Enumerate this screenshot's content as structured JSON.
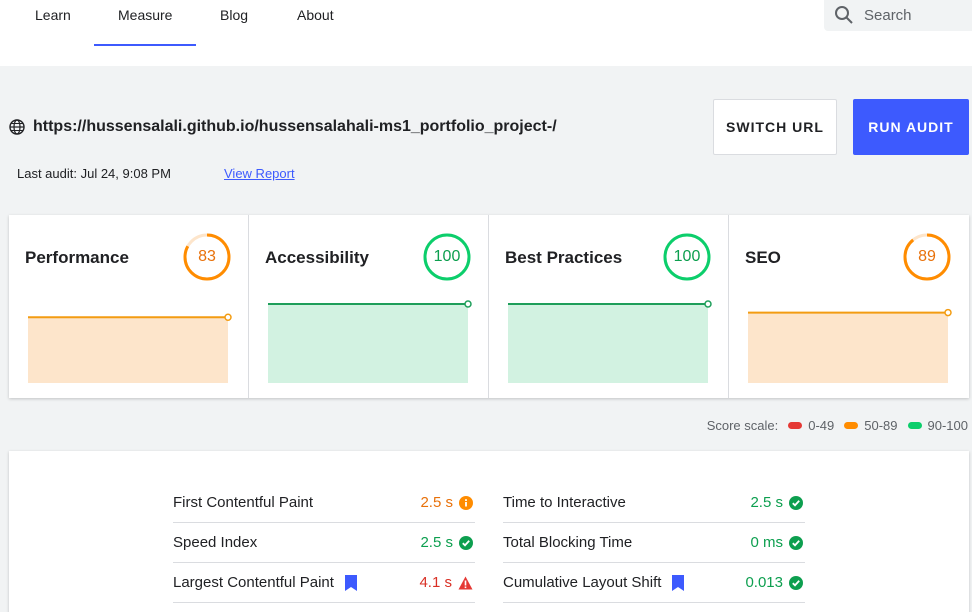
{
  "nav": {
    "items": [
      {
        "label": "Learn",
        "active": false
      },
      {
        "label": "Measure",
        "active": true
      },
      {
        "label": "Blog",
        "active": false
      },
      {
        "label": "About",
        "active": false
      }
    ],
    "search_placeholder": "Search"
  },
  "audit": {
    "url": "https://hussensalali.github.io/hussensalahali-ms1_portfolio_project-/",
    "switch_label": "SWITCH URL",
    "run_label": "RUN AUDIT",
    "last_audit": "Last audit: Jul 24, 9:08 PM",
    "view_report": "View Report"
  },
  "scores": [
    {
      "title": "Performance",
      "score": "83",
      "value": 83,
      "status": "average"
    },
    {
      "title": "Accessibility",
      "score": "100",
      "value": 100,
      "status": "pass"
    },
    {
      "title": "Best Practices",
      "score": "100",
      "value": 100,
      "status": "pass"
    },
    {
      "title": "SEO",
      "score": "89",
      "value": 89,
      "status": "average"
    }
  ],
  "colors": {
    "pass": "#0cce6b",
    "pass_text": "#0d9f4f",
    "pass_line": "#1e9e5a",
    "pass_fill": "#d2f2e1",
    "average": "#ff8c00",
    "average_text": "#e8710a",
    "average_line": "#f39c12",
    "average_fill": "#fde5cb",
    "fail": "#e53935",
    "fail_text": "#d93025",
    "accent": "#3d5afe"
  },
  "scale": {
    "label": "Score scale:",
    "ranges": [
      "0-49",
      "50-89",
      "90-100"
    ]
  },
  "metrics": {
    "left": [
      {
        "name": "First Contentful Paint",
        "value": "2.5 s",
        "status": "average",
        "bookmark": false
      },
      {
        "name": "Speed Index",
        "value": "2.5 s",
        "status": "pass",
        "bookmark": false
      },
      {
        "name": "Largest Contentful Paint",
        "value": "4.1 s",
        "status": "fail",
        "bookmark": true
      }
    ],
    "right": [
      {
        "name": "Time to Interactive",
        "value": "2.5 s",
        "status": "pass",
        "bookmark": false
      },
      {
        "name": "Total Blocking Time",
        "value": "0 ms",
        "status": "pass",
        "bookmark": false
      },
      {
        "name": "Cumulative Layout Shift",
        "value": "0.013",
        "status": "pass",
        "bookmark": true
      }
    ]
  }
}
